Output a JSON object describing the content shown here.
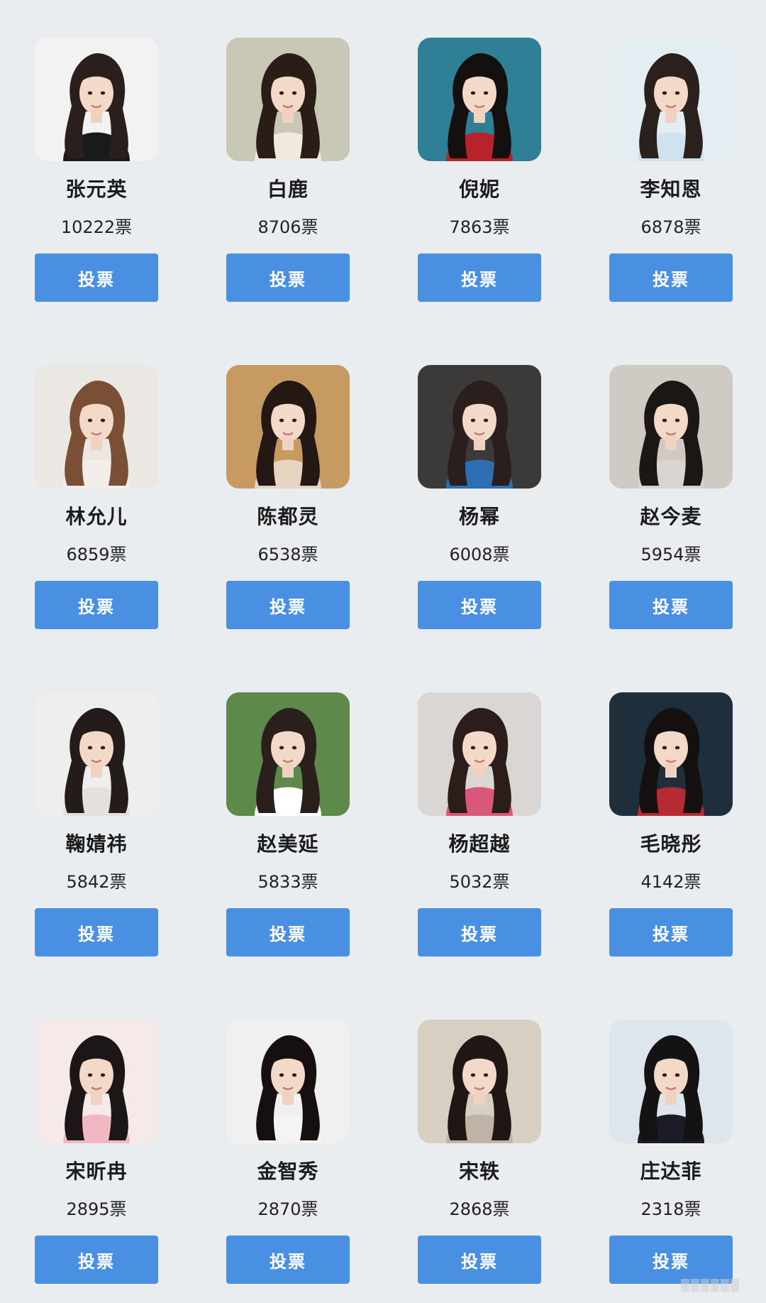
{
  "button_label": "投票",
  "colors": {
    "background": "#e9edf0",
    "button": "#4a90e2",
    "button_text": "#ffffff"
  },
  "candidates": [
    {
      "name": "张元英",
      "votes": "10222票"
    },
    {
      "name": "白鹿",
      "votes": "8706票"
    },
    {
      "name": "倪妮",
      "votes": "7863票"
    },
    {
      "name": "李知恩",
      "votes": "6878票"
    },
    {
      "name": "林允儿",
      "votes": "6859票"
    },
    {
      "name": "陈都灵",
      "votes": "6538票"
    },
    {
      "name": "杨幂",
      "votes": "6008票"
    },
    {
      "name": "赵今麦",
      "votes": "5954票"
    },
    {
      "name": "鞠婧祎",
      "votes": "5842票"
    },
    {
      "name": "赵美延",
      "votes": "5833票"
    },
    {
      "name": "杨超越",
      "votes": "5032票"
    },
    {
      "name": "毛晓彤",
      "votes": "4142票"
    },
    {
      "name": "宋昕冉",
      "votes": "2895票"
    },
    {
      "name": "金智秀",
      "votes": "2870票"
    },
    {
      "name": "宋轶",
      "votes": "2868票"
    },
    {
      "name": "庄达菲",
      "votes": "2318票"
    }
  ]
}
